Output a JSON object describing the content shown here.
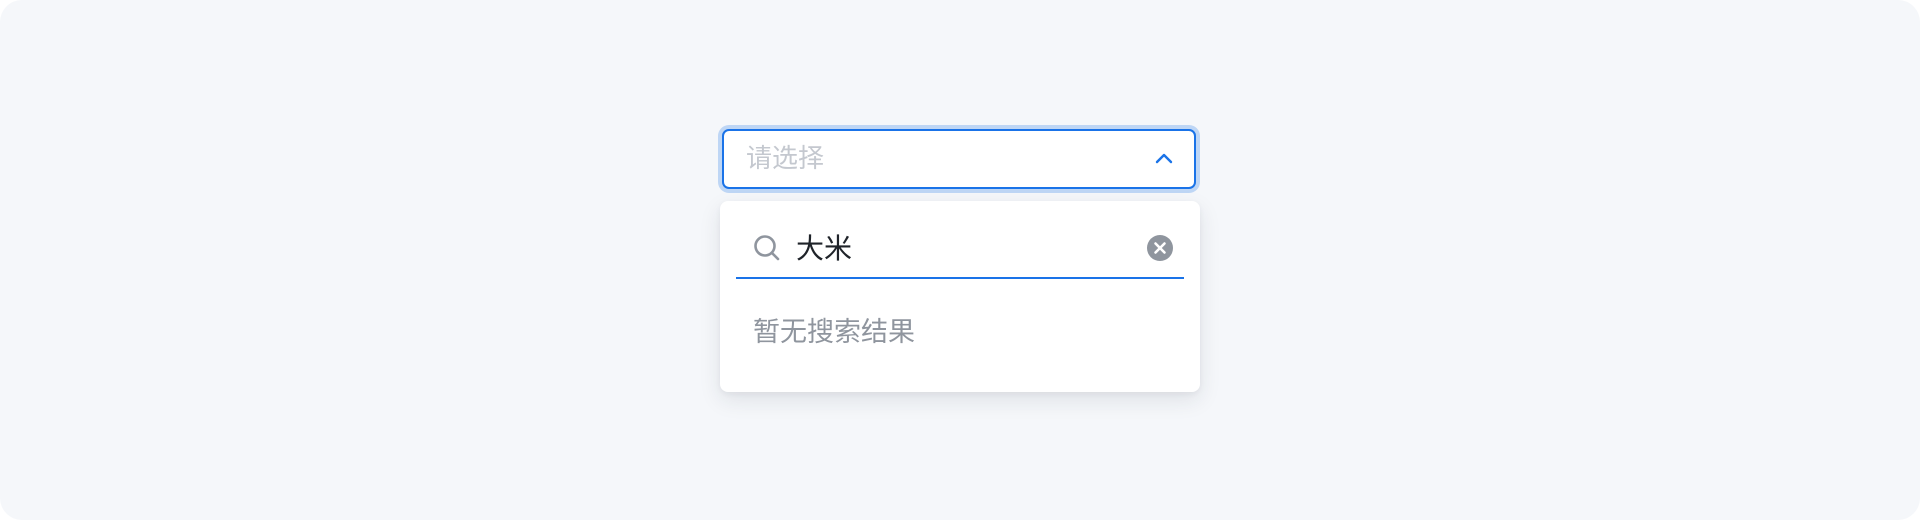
{
  "select": {
    "placeholder": "请选择",
    "expanded": true
  },
  "search": {
    "value": "大米"
  },
  "dropdown": {
    "empty_text": "暂无搜索结果"
  },
  "icons": {
    "chevron": "chevron-up-icon",
    "search": "search-icon",
    "clear": "clear-circle-icon"
  },
  "colors": {
    "accent": "#1a73e8",
    "background": "#f5f7fa",
    "placeholder": "#c4c8cf",
    "muted_text": "#8f959e",
    "icon_gray": "#8f959e"
  }
}
